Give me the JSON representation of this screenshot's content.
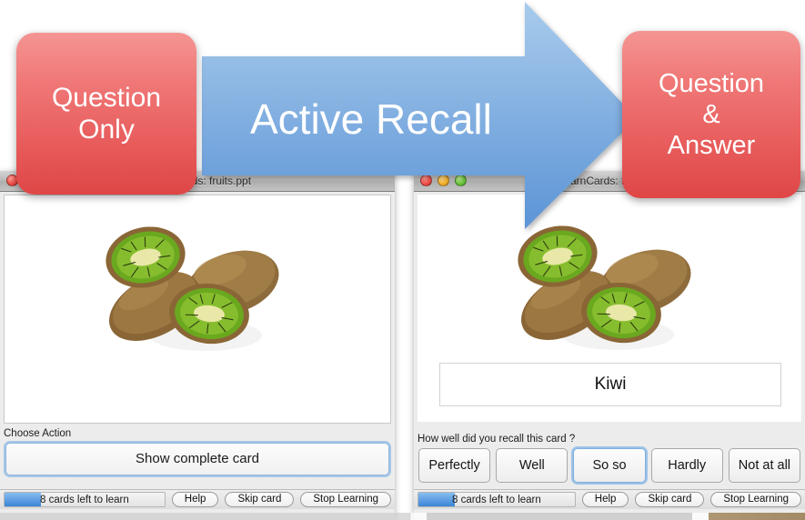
{
  "overlay": {
    "left_badge": {
      "line1": "Question",
      "line2": "Only"
    },
    "right_badge": {
      "line1": "Question",
      "line2": "&",
      "line3": "Answer"
    },
    "arrow_label": "Active Recall",
    "colors": {
      "badge_red_top": "#f49593",
      "badge_red_bottom": "#df4646",
      "arrow_blue_top": "#9ec3e8",
      "arrow_blue_bottom": "#5b94d6",
      "focus_blue": "#6ca8e4"
    }
  },
  "left_window": {
    "title": "iLearnCards: fruits.ppt",
    "traffic_lights": [
      "close-button",
      "minimize-button",
      "zoom-button"
    ],
    "card_image_alt": "kiwi-fruit-photo",
    "panel": {
      "label": "Choose Action",
      "action_button": "Show complete card"
    },
    "status": {
      "progress_text": "8 cards left to learn",
      "progress_percent": 23,
      "buttons": [
        "Help",
        "Skip card",
        "Stop Learning"
      ]
    }
  },
  "right_window": {
    "title": "iLearnCards: fruits.ppt",
    "traffic_lights": [
      "close-button",
      "minimize-button",
      "zoom-button"
    ],
    "card_image_alt": "kiwi-fruit-photo",
    "answer": "Kiwi",
    "panel": {
      "label": "How well did you recall this card ?",
      "rating_buttons": [
        {
          "label": "Perfectly",
          "focused": false
        },
        {
          "label": "Well",
          "focused": false
        },
        {
          "label": "So so",
          "focused": true
        },
        {
          "label": "Hardly",
          "focused": false
        },
        {
          "label": "Not at all",
          "focused": false
        }
      ]
    },
    "status": {
      "progress_text": "8 cards left to learn",
      "progress_percent": 23,
      "buttons": [
        "Help",
        "Skip card",
        "Stop Learning"
      ]
    }
  }
}
